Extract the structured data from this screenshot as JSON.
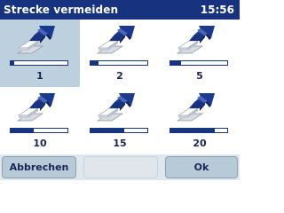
{
  "header": {
    "title": "Strecke vermeiden",
    "clock": "15:56"
  },
  "options": [
    {
      "label": "1",
      "fill": 0.06,
      "selected": true
    },
    {
      "label": "2",
      "fill": 0.14,
      "selected": false
    },
    {
      "label": "5",
      "fill": 0.18,
      "selected": false
    },
    {
      "label": "10",
      "fill": 0.4,
      "selected": false
    },
    {
      "label": "15",
      "fill": 0.6,
      "selected": false
    },
    {
      "label": "20",
      "fill": 0.78,
      "selected": false
    }
  ],
  "buttons": {
    "cancel": "Abbrechen",
    "ok": "Ok"
  },
  "colors": {
    "title_bg": "#17327e",
    "accent": "#173480",
    "selected_bg": "#bcd0de",
    "button_bg": "#b7cad8"
  },
  "icon": "route-arrow-icon"
}
